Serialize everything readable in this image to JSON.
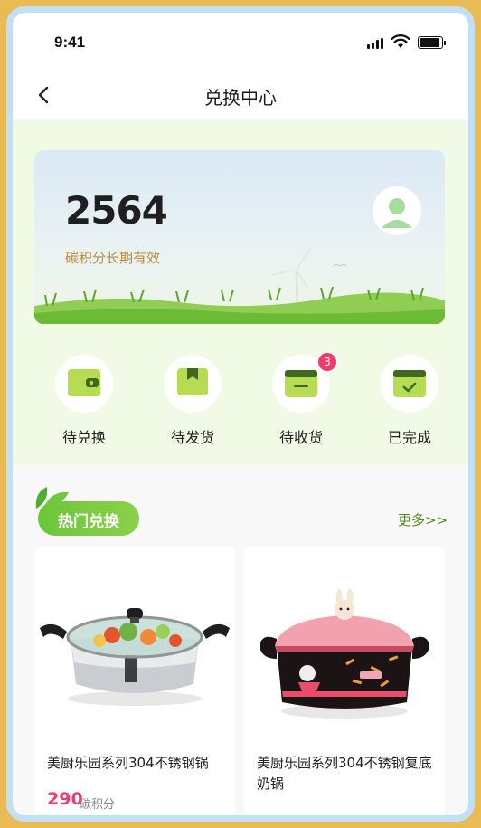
{
  "status_bar": {
    "time": "9:41"
  },
  "header": {
    "title": "兑换中心"
  },
  "points_card": {
    "points": "2564",
    "note": "碳积分长期有效"
  },
  "quick_actions": [
    {
      "label": "待兑换",
      "icon": "wallet-icon"
    },
    {
      "label": "待发货",
      "icon": "box-icon"
    },
    {
      "label": "待收货",
      "icon": "shipment-icon",
      "badge": "3"
    },
    {
      "label": "已完成",
      "icon": "completed-icon"
    }
  ],
  "hot_section": {
    "title": "热门兑换",
    "more_label": "更多>>"
  },
  "products": [
    {
      "name": "美厨乐园系列304不锈钢锅",
      "price": "290",
      "unit": "碳积分"
    },
    {
      "name": "美厨乐园系列304不锈钢复底奶锅"
    }
  ],
  "colors": {
    "accent_green": "#7cc94a",
    "price_pink": "#e83e73",
    "badge_red": "#ef3d6a",
    "note_gold": "#b88a3e"
  }
}
